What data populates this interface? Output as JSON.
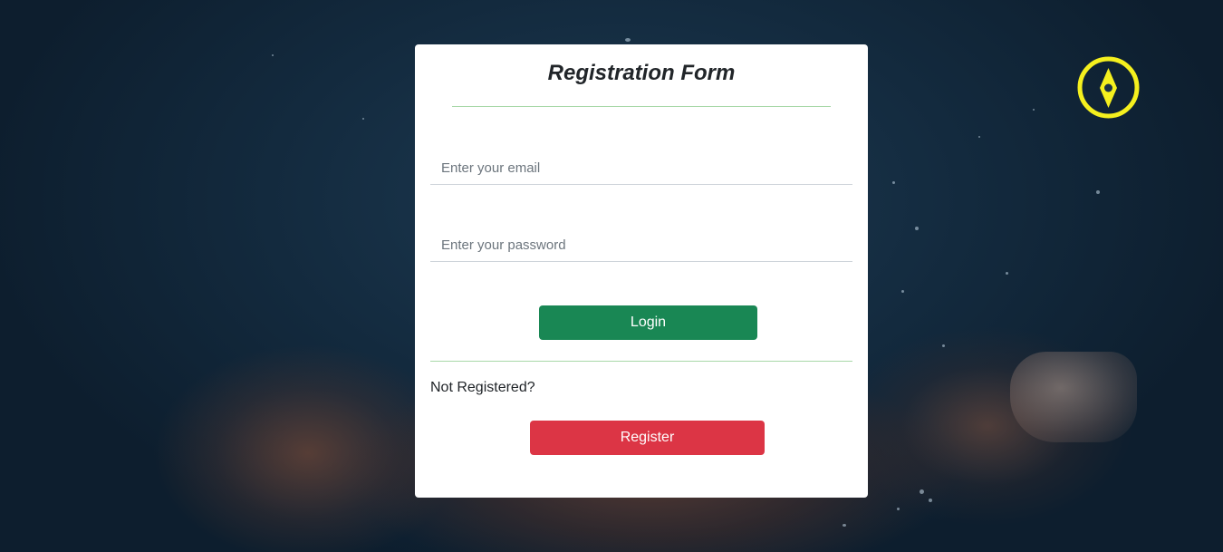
{
  "form": {
    "title": "Registration Form",
    "email_placeholder": "Enter your email",
    "password_placeholder": "Enter your password",
    "login_label": "Login",
    "not_registered_text": "Not Registered?",
    "register_label": "Register"
  },
  "icons": {
    "compass": "compass-icon"
  },
  "colors": {
    "login_button": "#198754",
    "register_button": "#dc3545",
    "compass_icon": "#f5f01e",
    "divider": "#a8d8a8"
  }
}
